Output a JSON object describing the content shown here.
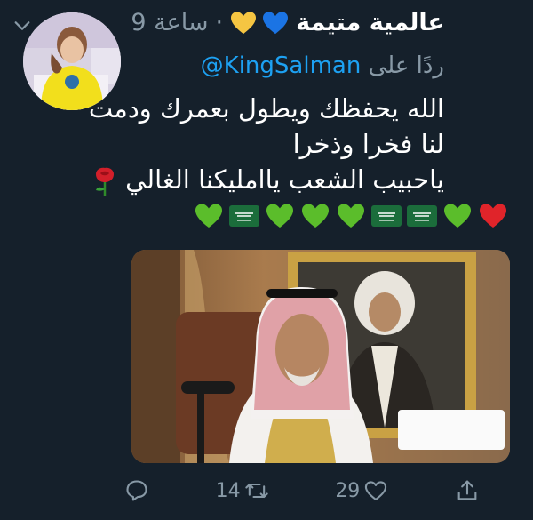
{
  "tweet": {
    "author": "عالمية متيمة",
    "time": "9 ساعة",
    "dot": "·",
    "reply_prefix": "ردًا على",
    "reply_handle": "@KingSalman",
    "lines": [
      "الله يحفظك ويطول بعمرك ودمت",
      "لنا فخرا وذخرا",
      "ياحبيب الشعب ياامليكنا الغالي"
    ],
    "header_hearts": [
      "yellow-heart-icon",
      "blue-heart-icon"
    ],
    "emoji_row": [
      "red-heart-icon",
      "green-heart-icon",
      "saudi-flag-icon",
      "saudi-flag-icon",
      "green-heart-icon",
      "green-heart-icon",
      "green-heart-icon",
      "saudi-flag-icon",
      "green-heart-icon"
    ],
    "colors": {
      "background": "#15202b",
      "secondary_text": "#8899a6",
      "link": "#1da1f2",
      "green_heart": "#5bbd2b",
      "red_heart": "#e0242a",
      "yellow_heart": "#f5c542",
      "blue_heart": "#1b74e4",
      "saudi_green": "#1b6d3b"
    }
  },
  "actions": {
    "reply_icon": "reply-icon",
    "retweet_count": "14",
    "retweet_icon": "retweet-icon",
    "like_count": "29",
    "like_icon": "like-icon",
    "share_icon": "share-icon"
  }
}
